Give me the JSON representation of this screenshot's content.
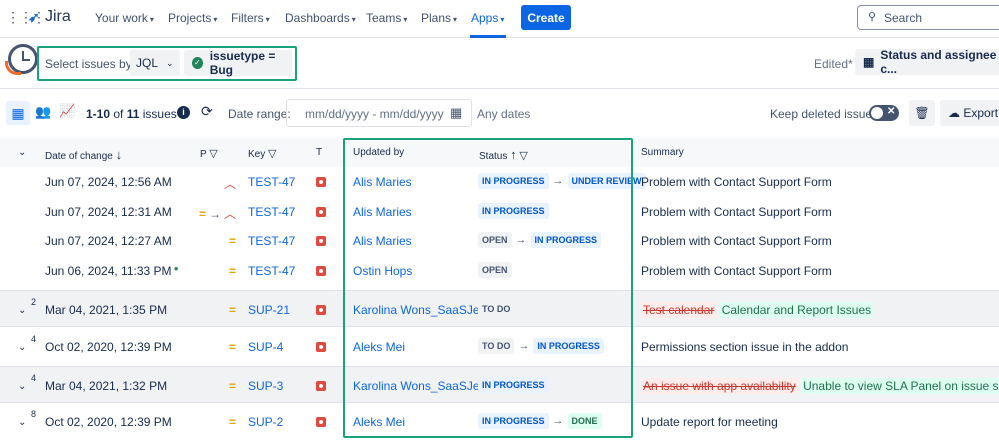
{
  "nav": {
    "logo": "Jira",
    "items": [
      "Your work",
      "Projects",
      "Filters",
      "Dashboards",
      "Teams",
      "Plans",
      "Apps"
    ],
    "create": "Create",
    "search_placeholder": "Search"
  },
  "filter": {
    "select_label": "Select issues by:",
    "select_value": "JQL",
    "query": "issuetype = Bug",
    "edited": "Edited*",
    "view_name": "Status and assignee c..."
  },
  "toolbar": {
    "range_prefix": "1-10",
    "of": "of",
    "total": "11",
    "issues": "issues",
    "date_range_label": "Date range:",
    "date_placeholder": "mm/dd/yyyy - mm/dd/yyyy",
    "any_dates": "Any dates",
    "keep_deleted": "Keep deleted issues",
    "export": "Export"
  },
  "table": {
    "headers": {
      "date": "Date of change",
      "p": "P",
      "key": "Key",
      "t": "T",
      "updated_by": "Updated by",
      "status": "Status",
      "summary": "Summary"
    },
    "rows": [
      {
        "count": "",
        "date": "Jun 07, 2024, 12:56 AM",
        "prio": [
          "high"
        ],
        "key": "TEST-47",
        "by": "Alis Maries",
        "status_from": "IN PROGRESS",
        "status_to": "UNDER REVIEW",
        "summary": "Problem with Contact Support Form",
        "summary_old": "",
        "group": false
      },
      {
        "count": "",
        "date": "Jun 07, 2024, 12:31 AM",
        "prio": [
          "medium",
          "high"
        ],
        "key": "TEST-47",
        "by": "Alis Maries",
        "status_from": "IN PROGRESS",
        "status_to": "",
        "summary": "Problem with Contact Support Form",
        "summary_old": "",
        "group": false
      },
      {
        "count": "",
        "date": "Jun 07, 2024, 12:27 AM",
        "prio": [
          "medium"
        ],
        "key": "TEST-47",
        "by": "Alis Maries",
        "status_from": "OPEN",
        "status_to": "IN PROGRESS",
        "summary": "Problem with Contact Support Form",
        "summary_old": "",
        "group": false
      },
      {
        "count": "",
        "date": "Jun 06, 2024, 11:33 PM",
        "prio": [
          "medium"
        ],
        "key": "TEST-47",
        "by": "Ostin Hops",
        "status_from": "OPEN",
        "status_to": "",
        "summary": "Problem with Contact Support Form",
        "summary_old": "",
        "group": false,
        "dot": true
      },
      {
        "count": "2",
        "date": "Mar 04, 2021, 1:35 PM",
        "prio": [
          "medium"
        ],
        "key": "SUP-21",
        "by": "Karolina Wons_SaaSJet",
        "status_from": "TO DO",
        "status_to": "",
        "summary": "Calendar and Report Issues",
        "summary_old": "Test calendar",
        "group": true
      },
      {
        "count": "4",
        "date": "Oct 02, 2020, 12:39 PM",
        "prio": [
          "medium"
        ],
        "key": "SUP-4",
        "by": "Aleks Mei",
        "status_from": "TO DO",
        "status_to": "IN PROGRESS",
        "summary": "Permissions section issue in the addon",
        "summary_old": "",
        "group": false
      },
      {
        "count": "4",
        "date": "Mar 04, 2021, 1:32 PM",
        "prio": [
          "medium"
        ],
        "key": "SUP-3",
        "by": "Karolina Wons_SaaSJet",
        "status_from": "IN PROGRESS",
        "status_to": "",
        "summary": "Unable to view SLA Panel on issue screen",
        "summary_old": "An issue with app availability",
        "group": true
      },
      {
        "count": "8",
        "date": "Oct 02, 2020, 12:39 PM",
        "prio": [
          "medium"
        ],
        "key": "SUP-2",
        "by": "Aleks Mei",
        "status_from": "IN PROGRESS",
        "status_to": "DONE",
        "summary": "Update report for meeting",
        "summary_old": "",
        "group": false
      }
    ]
  },
  "colors": {
    "accent": "#0c66e4",
    "highlight": "#1aa37a",
    "bug": "#e2483d"
  }
}
